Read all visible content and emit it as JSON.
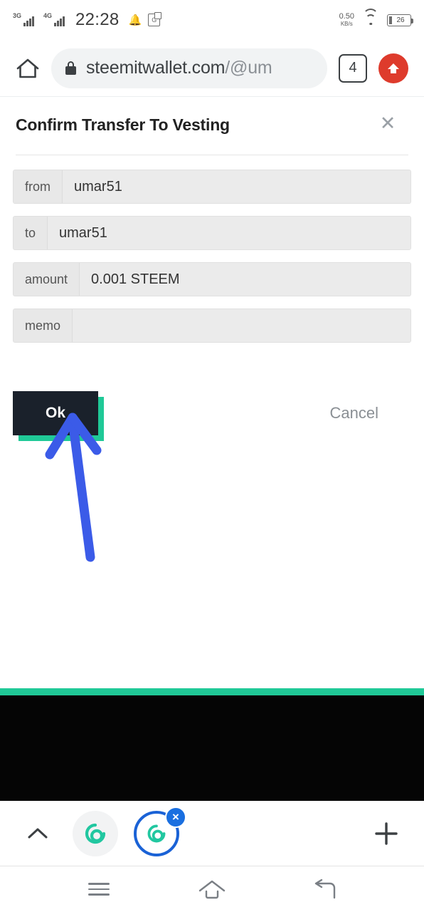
{
  "status_bar": {
    "network_1": "3G",
    "network_2": "4G",
    "time": "22:28",
    "bell_icon": "bell-icon",
    "app_icon": "app-notification-icon",
    "net_speed_value": "0.50",
    "net_speed_unit": "KB/s",
    "wifi_icon": "wifi-icon",
    "battery_level": "26"
  },
  "browser": {
    "home_icon": "home-icon",
    "lock_icon": "lock-icon",
    "url_visible": "steemitwallet.com",
    "url_path": "/@um",
    "tab_count": "4",
    "menu_icon": "up-arrow-menu-icon"
  },
  "dialog": {
    "title": "Confirm Transfer To Vesting",
    "close_icon": "close-icon",
    "fields": [
      {
        "label": "from",
        "value": "umar51",
        "name": "from"
      },
      {
        "label": "to",
        "value": "umar51",
        "name": "to"
      },
      {
        "label": "amount",
        "value": "0.001 STEEM",
        "name": "amount"
      },
      {
        "label": "memo",
        "value": "",
        "name": "memo"
      }
    ],
    "ok_label": "Ok",
    "cancel_label": "Cancel"
  },
  "annotation": {
    "arrow_color": "#3b5be8",
    "points_to": "Ok"
  },
  "colors": {
    "accent_green": "#20c997",
    "ok_button_bg": "#1a212b",
    "menu_red": "#de3b2c",
    "tab_ring_blue": "#1a62d6"
  },
  "bottom_toolbar": {
    "collapse_icon": "chevron-up-icon",
    "tab_1_icon": "steem-favicon",
    "tab_2_icon": "steem-favicon",
    "tab_close_badge": "×",
    "new_tab_icon": "plus-icon"
  },
  "android_nav": {
    "recents_icon": "menu-icon",
    "home_icon": "home-icon",
    "back_icon": "back-icon"
  }
}
